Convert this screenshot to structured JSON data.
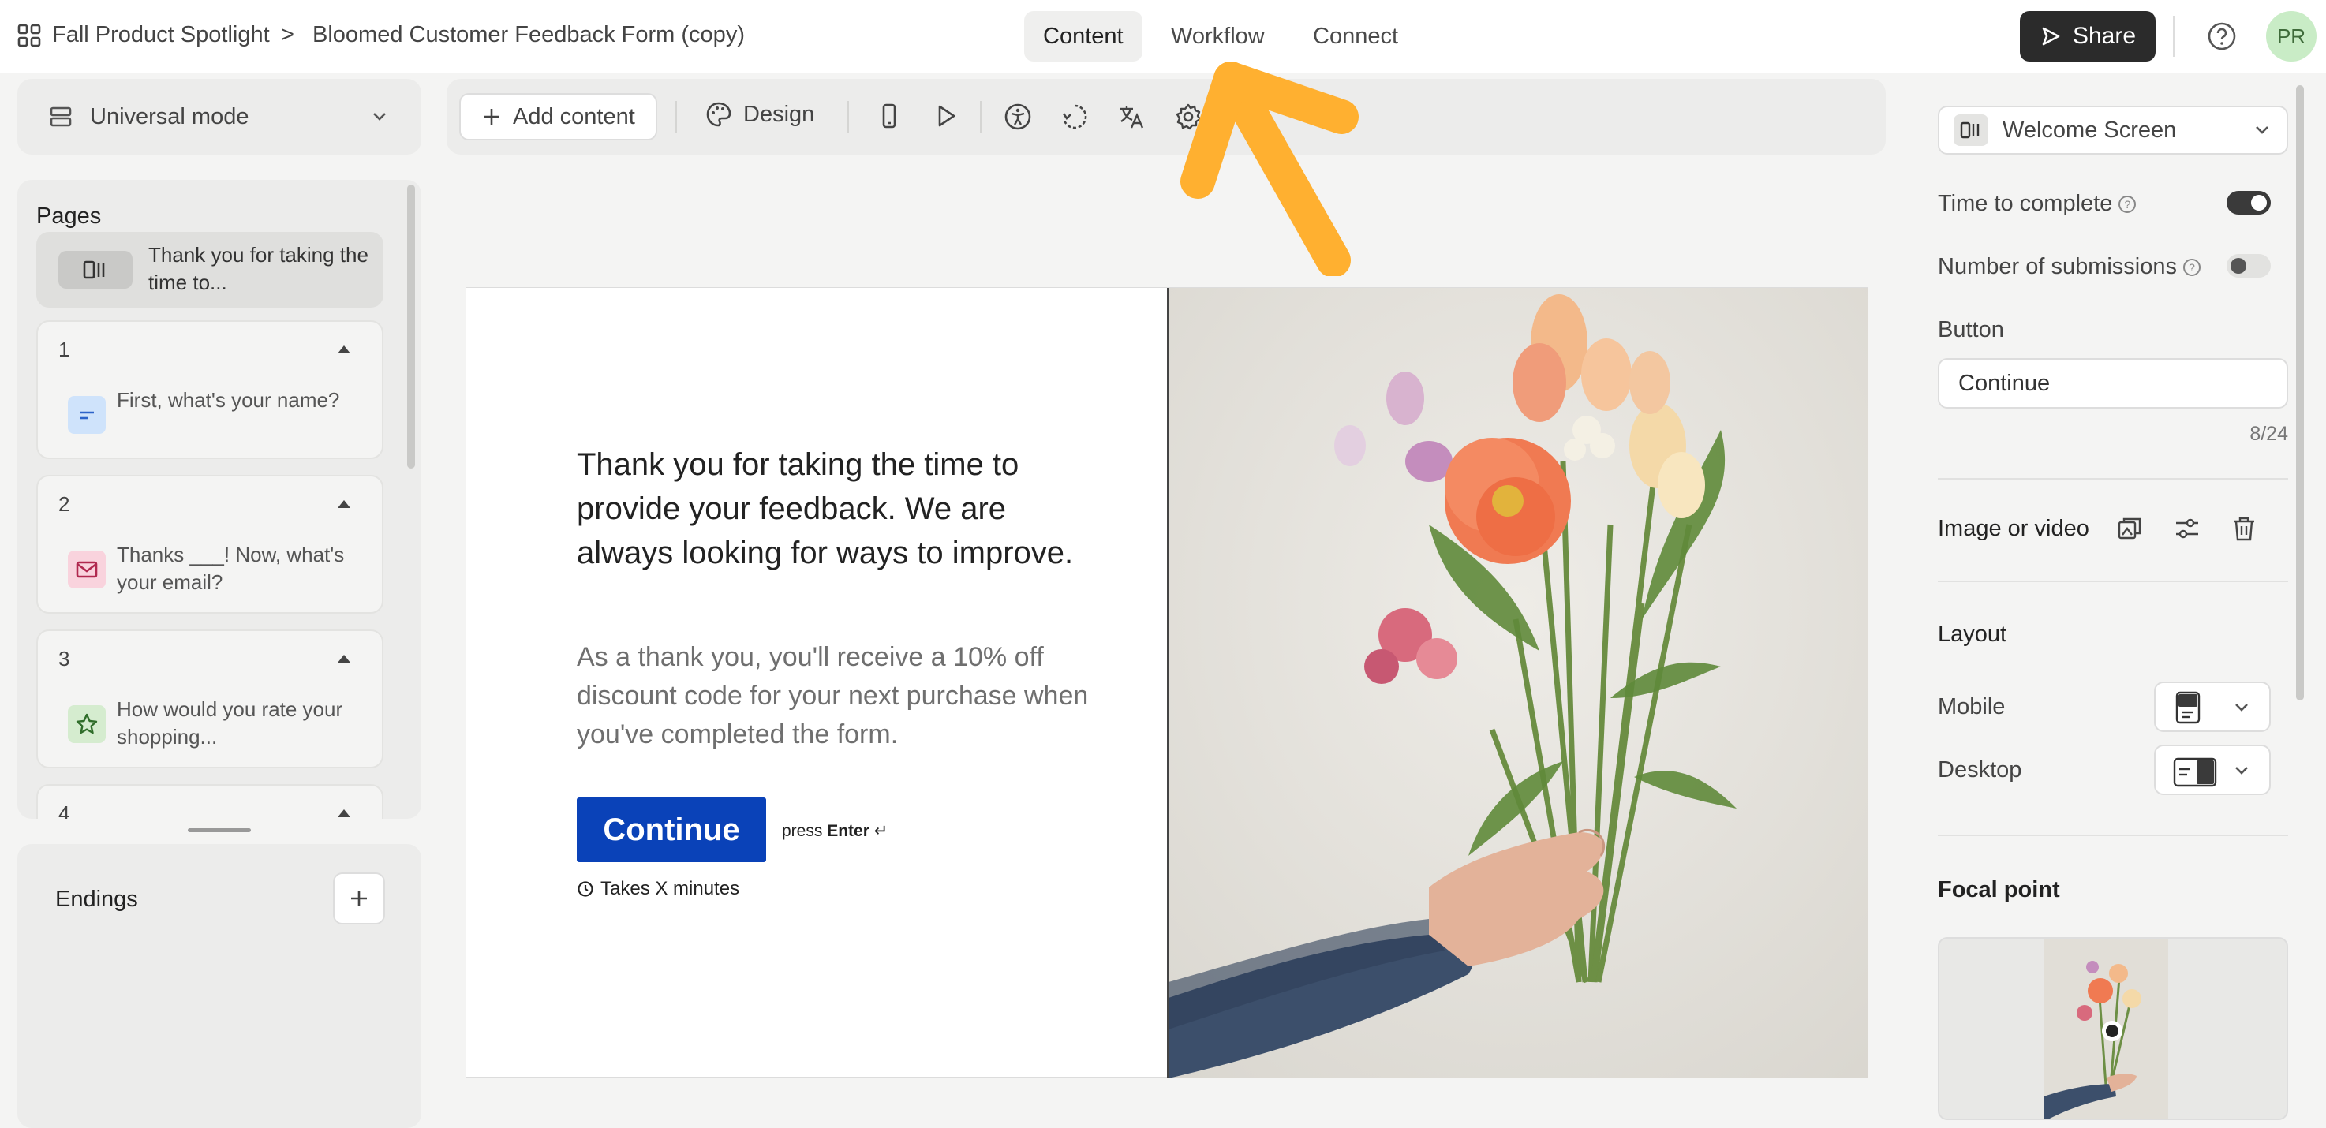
{
  "topbar": {
    "breadcrumb_parent": "Fall Product Spotlight",
    "breadcrumb_separator": ">",
    "form_title": "Bloomed Customer Feedback Form (copy)",
    "tabs": [
      {
        "label": "Content",
        "active": true
      },
      {
        "label": "Workflow",
        "active": false
      },
      {
        "label": "Connect",
        "active": false
      }
    ],
    "share_label": "Share",
    "avatar_initials": "PR"
  },
  "sidebar": {
    "mode_label": "Universal mode",
    "pages_heading": "Pages",
    "welcome_item": "Thank you for taking the time to...",
    "questions": [
      {
        "number": "1",
        "text": "First, what's your name?",
        "icon": "short-text-icon",
        "color": "#cfe3fb"
      },
      {
        "number": "2",
        "text": "Thanks ___! Now, what's your email?",
        "icon": "email-icon",
        "color": "#f9d3dd"
      },
      {
        "number": "3",
        "text": "How would you rate your shopping...",
        "icon": "star-icon",
        "color": "#d5eccf"
      },
      {
        "number": "4",
        "text": "",
        "icon": "",
        "color": "#eeeeee"
      }
    ],
    "endings_heading": "Endings"
  },
  "toolbar": {
    "add_content_label": "Add content",
    "design_label": "Design",
    "icons": [
      "mobile-preview-icon",
      "play-icon",
      "accessibility-icon",
      "logic-icon",
      "translate-icon",
      "settings-icon"
    ]
  },
  "form_preview": {
    "title": "Thank you for taking the time to provide your feedback. We are always looking for ways to improve.",
    "description": "As a thank you, you'll receive a 10% off discount code for your next purchase when you've completed the form.",
    "button_label": "Continue",
    "press_hint_prefix": "press",
    "press_hint_key": "Enter",
    "press_hint_symbol": "↵",
    "time_text": "Takes X minutes",
    "accent_color": "#0a42b8"
  },
  "settings": {
    "screen_type": "Welcome Screen",
    "time_to_complete_label": "Time to complete",
    "time_to_complete_on": true,
    "submissions_label": "Number of submissions",
    "submissions_on": false,
    "button_heading": "Button",
    "button_value": "Continue",
    "char_count": "8/24",
    "image_label": "Image or video",
    "layout_heading": "Layout",
    "mobile_label": "Mobile",
    "desktop_label": "Desktop",
    "focal_heading": "Focal point"
  }
}
